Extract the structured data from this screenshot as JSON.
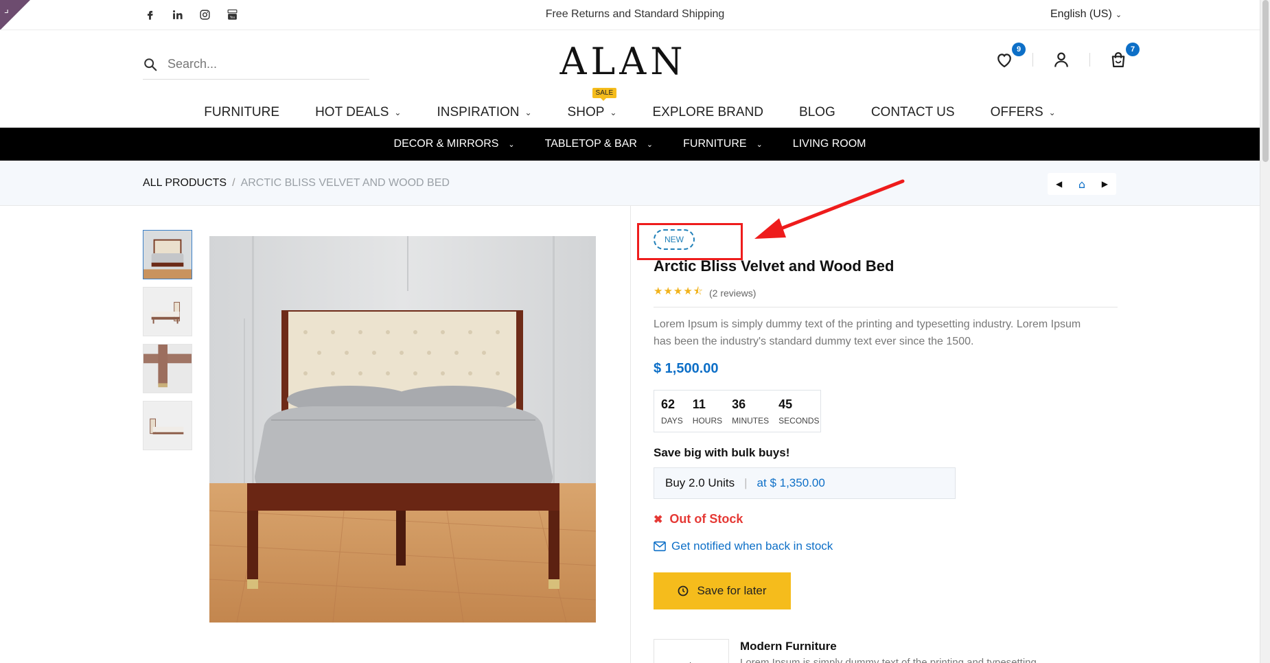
{
  "topbar": {
    "promo": "Free Returns and Standard Shipping",
    "language": "English (US)",
    "social": [
      "facebook-icon",
      "linkedin-icon",
      "instagram-icon",
      "youtube-icon"
    ]
  },
  "header": {
    "logo": "ALAN",
    "search_placeholder": "Search...",
    "wishlist_count": "9",
    "cart_count": "7"
  },
  "main_nav": {
    "items": [
      {
        "label": "FURNITURE",
        "dropdown": false
      },
      {
        "label": "HOT DEALS",
        "dropdown": true
      },
      {
        "label": "INSPIRATION",
        "dropdown": true
      },
      {
        "label": "SHOP",
        "dropdown": true,
        "tag": "SALE"
      },
      {
        "label": "EXPLORE BRAND",
        "dropdown": false
      },
      {
        "label": "BLOG",
        "dropdown": false
      },
      {
        "label": "CONTACT US",
        "dropdown": false
      },
      {
        "label": "OFFERS",
        "dropdown": true
      }
    ]
  },
  "sub_nav": {
    "items": [
      {
        "label": "DECOR & MIRRORS",
        "dropdown": true
      },
      {
        "label": "TABLETOP & BAR",
        "dropdown": true
      },
      {
        "label": "FURNITURE",
        "dropdown": true
      },
      {
        "label": "LIVING ROOM",
        "dropdown": false
      }
    ]
  },
  "breadcrumb": {
    "root": "ALL PRODUCTS",
    "separator": "/",
    "current": "ARCTIC BLISS VELVET AND WOOD BED"
  },
  "product": {
    "badge": "NEW",
    "title": "Arctic Bliss Velvet and Wood Bed",
    "rating": 4.5,
    "stars": "★★★★⯪",
    "reviews": "(2 reviews)",
    "description": "Lorem Ipsum is simply dummy text of the printing and typesetting industry. Lorem Ipsum has been the industry's standard dummy text ever since the 1500.",
    "price": "$ 1,500.00",
    "countdown": [
      {
        "value": "62",
        "label": "DAYS"
      },
      {
        "value": "11",
        "label": "HOURS"
      },
      {
        "value": "36",
        "label": "MINUTES"
      },
      {
        "value": "45",
        "label": "SECONDS"
      }
    ],
    "bulk_title": "Save big with bulk buys!",
    "bulk_units": "Buy 2.0 Units",
    "bulk_at": "at",
    "bulk_price": "$ 1,350.00",
    "stock_status": "Out of Stock",
    "notify_label": "Get notified when back in stock",
    "save_button": "Save for later",
    "feature_title": "Modern Furniture",
    "feature_desc": "Lorem Ipsum is simply dummy text of the printing and typesetting"
  },
  "colors": {
    "accent": "#0d6fc7",
    "button": "#f5bc1c",
    "stock_out": "#e53935",
    "annotation": "#ee1c1c"
  }
}
